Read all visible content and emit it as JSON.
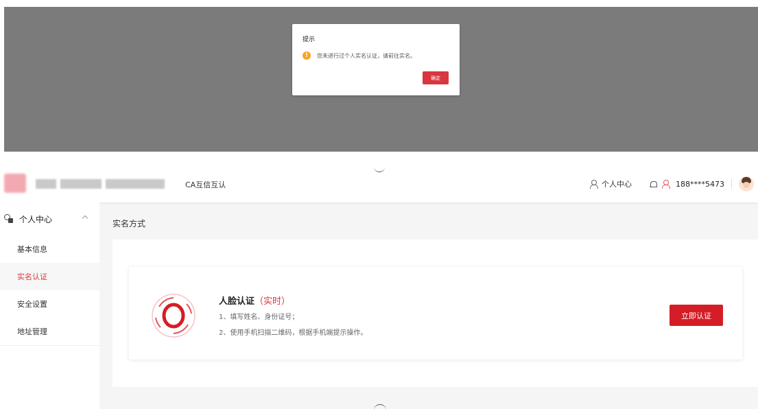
{
  "modal": {
    "title": "提示",
    "message": "您未进行过个人实名认证，请前往实名。",
    "confirm_label": "确定",
    "icon": "warning-icon"
  },
  "header": {
    "brand": "CA互信互认",
    "personal_center": "个人中心",
    "phone": "188****5473",
    "icons": [
      "user-icon",
      "bell-icon",
      "user-red-icon",
      "avatar"
    ]
  },
  "sidebar": {
    "group_label": "个人中心",
    "items": [
      {
        "label": "基本信息"
      },
      {
        "label": "实名认证",
        "active": true
      },
      {
        "label": "安全设置"
      },
      {
        "label": "地址管理"
      }
    ]
  },
  "main": {
    "section_title": "实名方式",
    "card": {
      "title": "人脸认证",
      "tag": "（实时）",
      "step1": "1、填写姓名、身份证号；",
      "step2": "2、使用手机扫描二维码，根据手机端提示操作。",
      "button_label": "立即认证"
    }
  },
  "colors": {
    "accent": "#d41d26",
    "warning": "#f5a623",
    "overlay": "#7b7b7b"
  }
}
